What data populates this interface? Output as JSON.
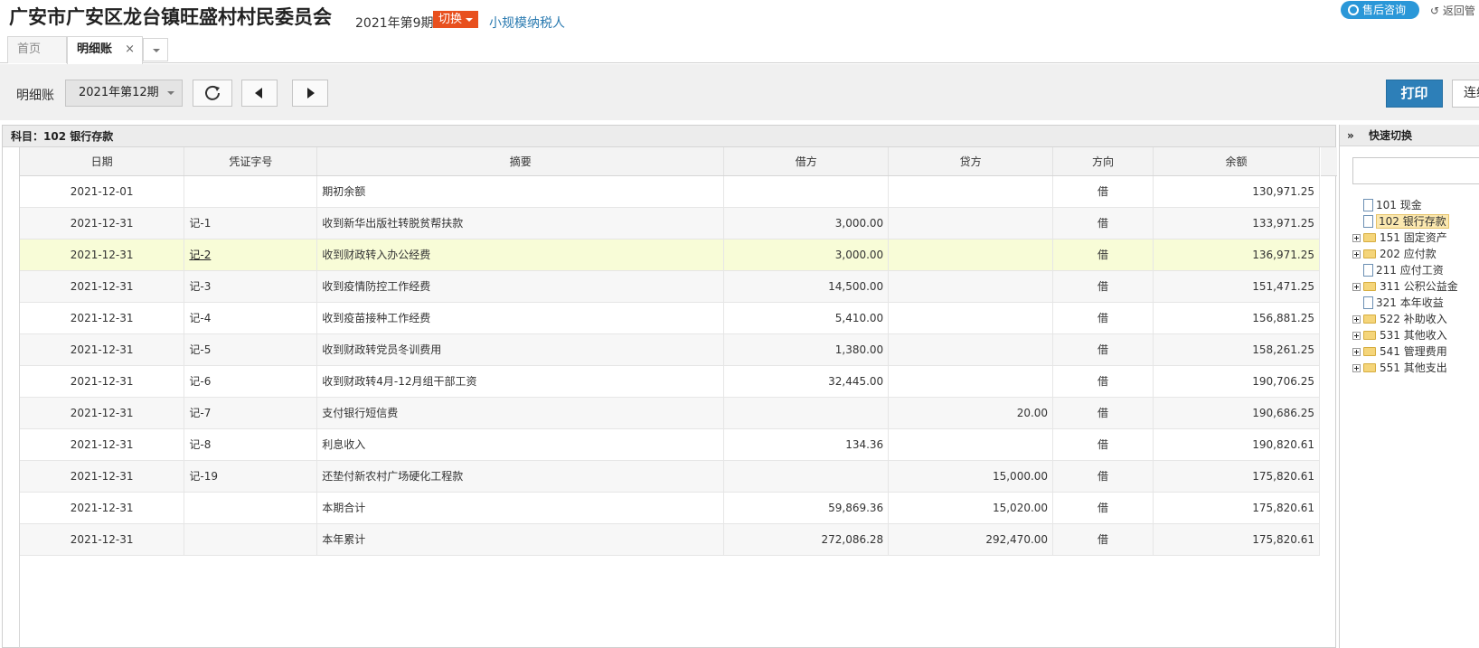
{
  "header": {
    "org_title": "广安市广安区龙台镇旺盛村村民委员会",
    "period": "2021年第9期",
    "switch_label": "切换",
    "taxpayer_type": "小规模纳税人",
    "support_label": "售后咨询",
    "back_label": "↺ 返回管"
  },
  "tabs": {
    "home_label": "首页",
    "active_label": "明细账",
    "close_glyph": "×"
  },
  "toolbar": {
    "label": "明细账",
    "period_value": "2021年第12期",
    "print_label": "打印",
    "continuous_label": "连续"
  },
  "subject": {
    "label": "科目：102  银行存款"
  },
  "columns": {
    "date": "日期",
    "voucher": "凭证字号",
    "summary": "摘要",
    "debit": "借方",
    "credit": "贷方",
    "direction": "方向",
    "balance": "余额"
  },
  "rows": [
    {
      "date": "2021-12-01",
      "voucher": "",
      "summary": "期初余额",
      "debit": "",
      "credit": "",
      "direction": "借",
      "balance": "130,971.25"
    },
    {
      "date": "2021-12-31",
      "voucher": "记-1",
      "summary": "收到新华出版社转脱贫帮扶款",
      "debit": "3,000.00",
      "credit": "",
      "direction": "借",
      "balance": "133,971.25"
    },
    {
      "date": "2021-12-31",
      "voucher": "记-2",
      "summary": "收到财政转入办公经费",
      "debit": "3,000.00",
      "credit": "",
      "direction": "借",
      "balance": "136,971.25"
    },
    {
      "date": "2021-12-31",
      "voucher": "记-3",
      "summary": "收到疫情防控工作经费",
      "debit": "14,500.00",
      "credit": "",
      "direction": "借",
      "balance": "151,471.25"
    },
    {
      "date": "2021-12-31",
      "voucher": "记-4",
      "summary": "收到疫苗接种工作经费",
      "debit": "5,410.00",
      "credit": "",
      "direction": "借",
      "balance": "156,881.25"
    },
    {
      "date": "2021-12-31",
      "voucher": "记-5",
      "summary": "收到财政转党员冬训费用",
      "debit": "1,380.00",
      "credit": "",
      "direction": "借",
      "balance": "158,261.25"
    },
    {
      "date": "2021-12-31",
      "voucher": "记-6",
      "summary": "收到财政转4月-12月组干部工资",
      "debit": "32,445.00",
      "credit": "",
      "direction": "借",
      "balance": "190,706.25"
    },
    {
      "date": "2021-12-31",
      "voucher": "记-7",
      "summary": "支付银行短信费",
      "debit": "",
      "credit": "20.00",
      "direction": "借",
      "balance": "190,686.25"
    },
    {
      "date": "2021-12-31",
      "voucher": "记-8",
      "summary": "利息收入",
      "debit": "134.36",
      "credit": "",
      "direction": "借",
      "balance": "190,820.61"
    },
    {
      "date": "2021-12-31",
      "voucher": "记-19",
      "summary": "还垫付新农村广场硬化工程款",
      "debit": "",
      "credit": "15,000.00",
      "direction": "借",
      "balance": "175,820.61"
    },
    {
      "date": "2021-12-31",
      "voucher": "",
      "summary": "本期合计",
      "debit": "59,869.36",
      "credit": "15,020.00",
      "direction": "借",
      "balance": "175,820.61"
    },
    {
      "date": "2021-12-31",
      "voucher": "",
      "summary": "本年累计",
      "debit": "272,086.28",
      "credit": "292,470.00",
      "direction": "借",
      "balance": "175,820.61"
    }
  ],
  "quick_switch": {
    "title": "快速切换",
    "chevron": "»",
    "items": [
      {
        "label": "101 现金",
        "kind": "doc"
      },
      {
        "label": "102 银行存款",
        "kind": "doc",
        "selected": true
      },
      {
        "label": "151 固定资产",
        "kind": "folder"
      },
      {
        "label": "202 应付款",
        "kind": "folder"
      },
      {
        "label": "211 应付工资",
        "kind": "doc"
      },
      {
        "label": "311 公积公益金",
        "kind": "folder"
      },
      {
        "label": "321 本年收益",
        "kind": "doc"
      },
      {
        "label": "522 补助收入",
        "kind": "folder"
      },
      {
        "label": "531 其他收入",
        "kind": "folder"
      },
      {
        "label": "541 管理费用",
        "kind": "folder"
      },
      {
        "label": "551 其他支出",
        "kind": "folder"
      }
    ]
  },
  "colors": {
    "accent": "#2d7fb8",
    "switch": "#e8501e",
    "highlight_row": "#f8fcd7"
  }
}
